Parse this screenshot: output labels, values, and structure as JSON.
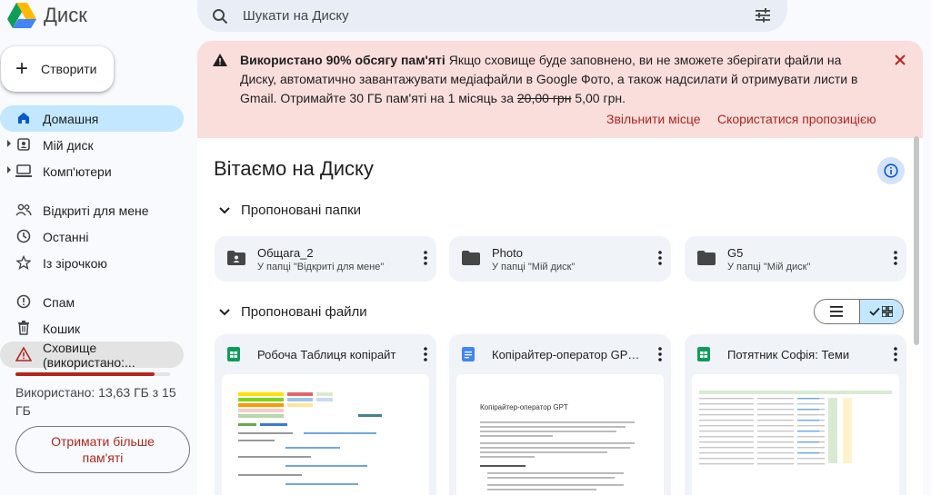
{
  "app": {
    "title": "Диск"
  },
  "sidebar": {
    "create_label": "Створити",
    "items": [
      {
        "label": "Домашня",
        "icon": "home-icon",
        "state": "active"
      },
      {
        "label": "Мій диск",
        "icon": "my-drive-icon",
        "expandable": true
      },
      {
        "label": "Комп'ютери",
        "icon": "computer-icon",
        "expandable": true
      },
      {
        "label": "Відкриті для мене",
        "icon": "shared-icon"
      },
      {
        "label": "Останні",
        "icon": "clock-icon"
      },
      {
        "label": "Із зірочкою",
        "icon": "star-icon"
      },
      {
        "label": "Спам",
        "icon": "spam-icon"
      },
      {
        "label": "Кошик",
        "icon": "trash-icon"
      },
      {
        "label": "Сховище (використано:...",
        "icon": "warning-icon",
        "state": "hover"
      }
    ],
    "storage": {
      "used_fraction": 0.9,
      "text": "Використано: 13,63 ГБ з 15 ГБ",
      "bar_color": "#b3261e"
    },
    "get_more_label": "Отримати більше пам'яті"
  },
  "search": {
    "placeholder": "Шукати на Диску"
  },
  "alert": {
    "title": "Використано 90% обсягу пам'яті",
    "body": " Якщо сховище буде заповнено, ви не зможете зберігати файли на Диску, автоматично завантажувати медіафайли в Google Фото, а також надсилати й отримувати листи в Gmail. Отримайте 30 ГБ пам'яті на 1 місяць за ",
    "old_price": "20,00 грн",
    "new_price": " 5,00 грн.",
    "action_free": "Звільнити місце",
    "action_offer": "Скористатися пропозицією",
    "bg_color": "#f9dedc",
    "accent_color": "#b3261e"
  },
  "main": {
    "welcome": "Вітаємо на Диску",
    "folders_header": "Пропоновані папки",
    "files_header": "Пропоновані файли",
    "folders": [
      {
        "name": "Общага_2",
        "location": "У папці \"Відкриті для мене\"",
        "icon": "shared-folder-icon"
      },
      {
        "name": "Photo",
        "location": "У папці \"Мій диск\"",
        "icon": "folder-icon"
      },
      {
        "name": "G5",
        "location": "У папці \"Мій диск\"",
        "icon": "folder-icon"
      }
    ],
    "files": [
      {
        "name": "Робоча Таблиця копірайт",
        "type": "sheets",
        "icon_color": "#0f9d58"
      },
      {
        "name": "Копірайтер-оператор GPT ...",
        "type": "docs",
        "icon_color": "#4285f4",
        "preview_title": "Копірайтер-оператор GPT"
      },
      {
        "name": "Потятник Софія: Теми",
        "type": "sheets",
        "icon_color": "#0f9d58"
      }
    ],
    "view_mode": "grid"
  }
}
